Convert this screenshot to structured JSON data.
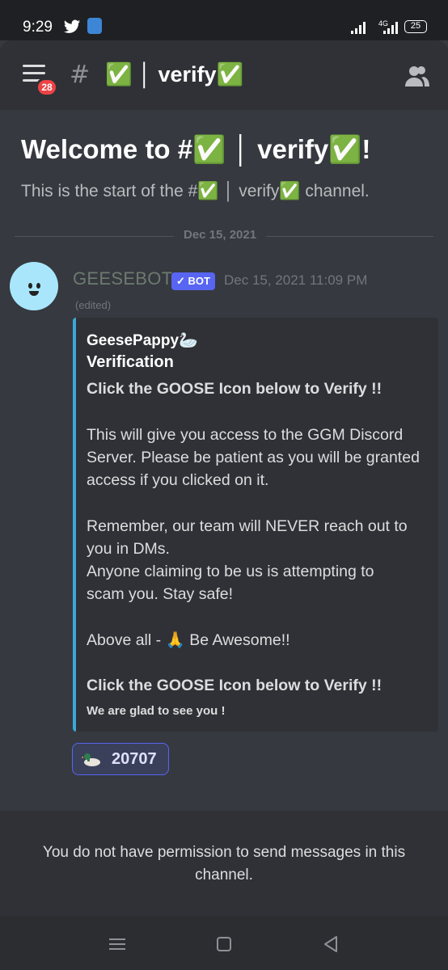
{
  "status_bar": {
    "time": "9:29",
    "network_label": "4G",
    "battery": "25"
  },
  "header": {
    "notification_count": "28",
    "channel_name": "✅ │ verify✅"
  },
  "welcome": {
    "title": "Welcome to #✅ │ verify✅!",
    "subtitle": "This is the start of the #✅ │ verify✅ channel."
  },
  "divider_date": "Dec 15, 2021",
  "message": {
    "author": "GEESEBOT",
    "bot_tag": "✓ BOT",
    "timestamp": "Dec 15, 2021 11:09 PM",
    "edited": "(edited)",
    "embed": {
      "author": "GeesePappy🦢",
      "title": "Verification",
      "lines": [
        "Click the GOOSE Icon below to Verify !!",
        "This will give you access to the GGM Discord",
        "Server. Please be patient as you will be granted",
        "access if you clicked on it.",
        "Remember, our team will NEVER reach out to",
        "you in DMs.",
        "Anyone claiming to be us is attempting to",
        "scam you. Stay safe!",
        "Above all - 🙏 Be Awesome!!",
        "Click the GOOSE Icon below to Verify !!"
      ],
      "footer": "We are glad to see you !"
    },
    "reaction": {
      "icon": "goose-emoji",
      "count": "20707"
    }
  },
  "no_permission_text": "You do not have permission to send messages in this channel.",
  "colors": {
    "background": "#36393f",
    "header": "#2f3136",
    "embed_bar": "#3ba8d6",
    "bot_tag": "#5865f2",
    "badge": "#ed4245"
  }
}
